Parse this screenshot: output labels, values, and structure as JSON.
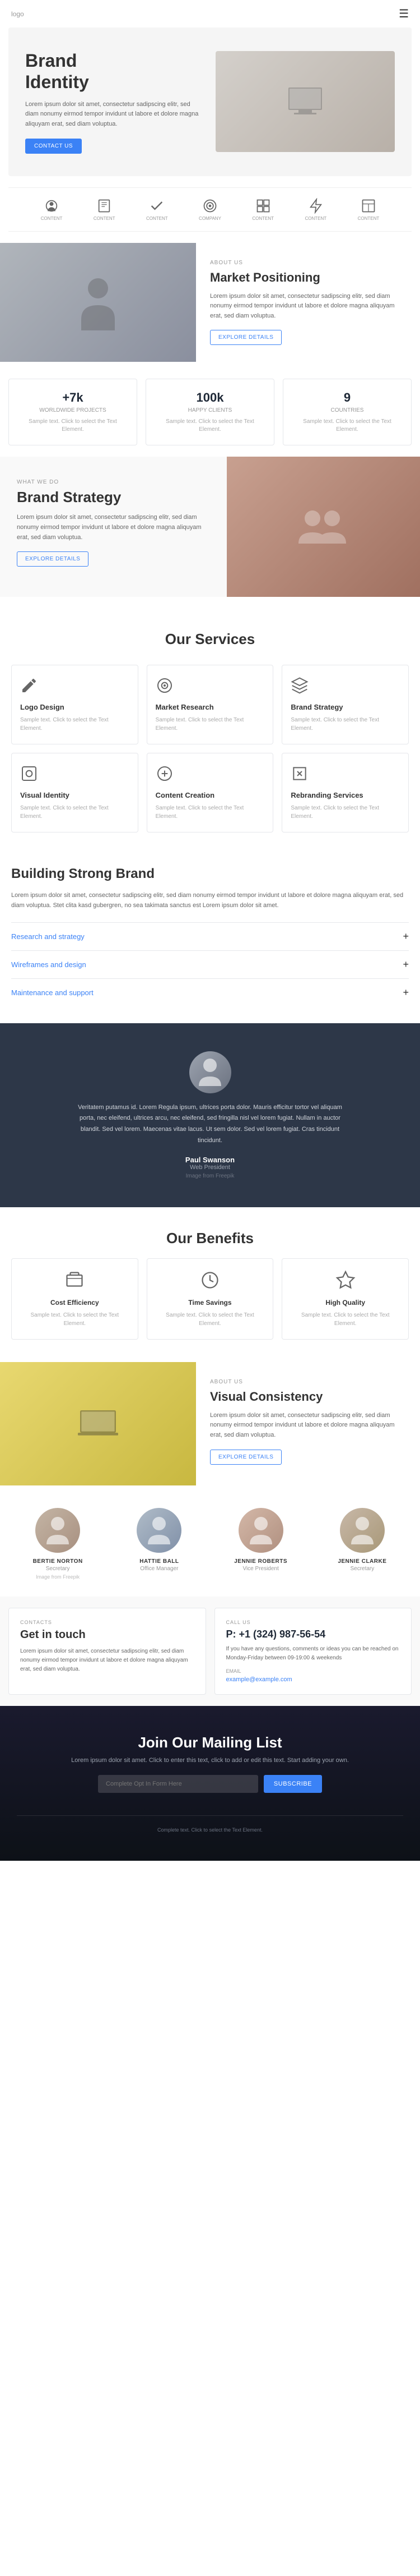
{
  "nav": {
    "logo": "logo",
    "menu_icon": "☰"
  },
  "hero": {
    "title_line1": "Brand",
    "title_line2": "Identity",
    "description": "Lorem ipsum dolor sit amet, consectetur sadipscing elitr, sed diam nonumy eirmod tempor invidunt ut labore et dolore magna aliquyam erat, sed diam voluptua.",
    "cta_label": "CONTACT US"
  },
  "icons_row": {
    "items": [
      {
        "icon": "○",
        "label": "CONTENT"
      },
      {
        "icon": "□",
        "label": "CONTENT"
      },
      {
        "icon": "✓",
        "label": "CONTENT"
      },
      {
        "icon": "◎",
        "label": "COMPANY"
      },
      {
        "icon": "⊞",
        "label": "CONTENT"
      },
      {
        "icon": "⚡",
        "label": "CONTENT"
      },
      {
        "icon": "⊟",
        "label": "CONTENT"
      }
    ]
  },
  "about": {
    "label": "ABOUT US",
    "title": "Market Positioning",
    "description": "Lorem ipsum dolor sit amet, consectetur sadipscing elitr, sed diam nonumy eirmod tempor invidunt ut labore et dolore magna aliquyam erat, sed diam voluptua.",
    "cta_label": "EXPLORE DETAILS"
  },
  "stats": [
    {
      "number": "+7k",
      "label": "Worldwide projects",
      "desc": "Sample text. Click to select the Text Element."
    },
    {
      "number": "100k",
      "label": "Happy clients",
      "desc": "Sample text. Click to select the Text Element."
    },
    {
      "number": "9",
      "label": "Countries",
      "desc": "Sample text. Click to select the Text Element."
    }
  ],
  "strategy": {
    "label": "WHAT WE DO",
    "title": "Brand Strategy",
    "description": "Lorem ipsum dolor sit amet, consectetur sadipscing elitr, sed diam nonumy eirmod tempor invidunt ut labore et dolore magna aliquyam erat, sed diam voluptua.",
    "cta_label": "EXPLORE DETAILS"
  },
  "services": {
    "section_title": "Our Services",
    "items": [
      {
        "icon": "✎",
        "title": "Logo Design",
        "desc": "Sample text. Click to select the Text Element."
      },
      {
        "icon": "⊙",
        "title": "Market Research",
        "desc": "Sample text. Click to select the Text Element."
      },
      {
        "icon": "◈",
        "title": "Brand Strategy",
        "desc": "Sample text. Click to select the Text Element."
      },
      {
        "icon": "◉",
        "title": "Visual Identity",
        "desc": "Sample text. Click to select the Text Element."
      },
      {
        "icon": "⊕",
        "title": "Content Creation",
        "desc": "Sample text. Click to select the Text Element."
      },
      {
        "icon": "↺",
        "title": "Rebranding Services",
        "desc": "Sample text. Click to select the Text Element."
      }
    ]
  },
  "building": {
    "title": "Building Strong Brand",
    "description": "Lorem ipsum dolor sit amet, consectetur sadipscing elitr, sed diam nonumy eirmod tempor invidunt ut labore et dolore magna aliquyam erat, sed diam voluptua. Stet clita kasd gubergren, no sea takimata sanctus est Lorem ipsum dolor sit amet.",
    "accordion": [
      {
        "label": "Research and strategy",
        "icon": "+"
      },
      {
        "label": "Wireframes and design",
        "icon": "+"
      },
      {
        "label": "Maintenance and support",
        "icon": "+"
      }
    ]
  },
  "testimonial": {
    "text": "Veritatem putamus id. Lorem Regula ipsum, ultrices porta dolor. Mauris efficitur tortor vel aliquam porta, nec eleifend, ultrices arcu, nec eleifend, sed fringilla nisl vel lorem fugiat. Nullam in auctor blandit. Sed vel lorem. Maecenas vitae lacus. Ut sem dolor. Sed vel lorem fugiat. Cras tincidunt tincidunt.",
    "name": "Paul Swanson",
    "role": "Web President",
    "source": "Image from Freepik"
  },
  "benefits": {
    "section_title": "Our Benefits",
    "items": [
      {
        "icon": "◫",
        "title": "Cost Efficiency",
        "desc": "Sample text. Click to select the Text Element."
      },
      {
        "icon": "⏱",
        "title": "Time Savings",
        "desc": "Sample text. Click to select the Text Element."
      },
      {
        "icon": "★",
        "title": "High Quality",
        "desc": "Sample text. Click to select the Text Element."
      }
    ]
  },
  "visual_consistency": {
    "label": "ABOUT US",
    "title": "Visual Consistency",
    "description": "Lorem ipsum dolor sit amet, consectetur sadipscing elitr, sed diam nonumy eirmod tempor invidunt ut labore et dolore magna aliquyam erat, sed diam voluptua.",
    "cta_label": "EXPLORE DETAILS"
  },
  "team": {
    "members": [
      {
        "name": "BERTIE NORTON",
        "role": "Secretary",
        "source": "Image from Freepik"
      },
      {
        "name": "HATTIE BALL",
        "role": "Office Manager",
        "source": ""
      },
      {
        "name": "JENNIE ROBERTS",
        "role": "Vice President",
        "source": ""
      },
      {
        "name": "JENNIE CLARKE",
        "role": "Secretary",
        "source": ""
      }
    ]
  },
  "contact": {
    "get_in_touch": {
      "label": "CONTACTS",
      "title": "Get in touch",
      "description": "Lorem ipsum dolor sit amet, consectetur sadipscing elitr, sed diam nonumy eirmod tempor invidunt ut labore et dolore magna aliquyam erat, sed diam voluptua."
    },
    "call_us": {
      "label": "CALL US",
      "phone": "P: +1 (324) 987-56-54",
      "description": "If you have any questions, comments or ideas you can be reached on Monday-Friday between 09-19:00 & weekends",
      "email_label": "EMAIL",
      "email": "example@example.com"
    }
  },
  "newsletter": {
    "title": "Join Our Mailing List",
    "description": "Lorem ipsum dolor sit amet. Click to enter this text, click to add or edit this text. Start adding your own.",
    "input_placeholder": "Complete Opt In Form Here",
    "subscribe_label": "SUBSCRIBE",
    "footer_text": "Complete text. Click to select the Text Element."
  },
  "colors": {
    "primary_blue": "#3b82f6",
    "dark_bg": "#1a1a2e",
    "testimonial_bg": "#2d3748",
    "light_gray": "#f5f5f5"
  }
}
